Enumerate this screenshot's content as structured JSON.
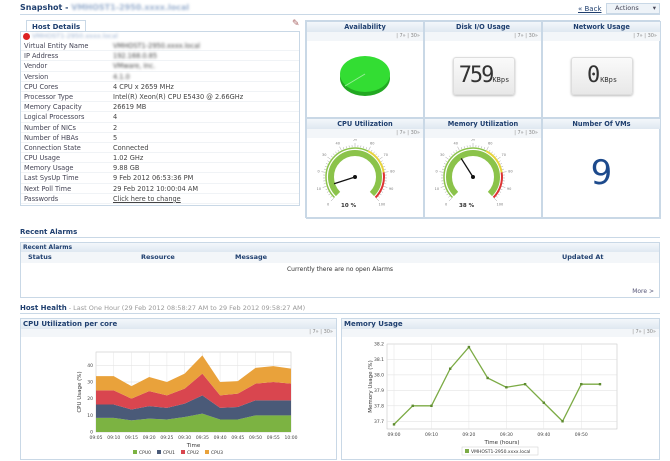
{
  "header": {
    "title": "Snapshot -",
    "host_name": "VMHOST1-2950.xxxx.local",
    "back_label": "« Back",
    "actions_label": "Actions"
  },
  "host_details": {
    "tab": "Host Details",
    "entity": "VMHOST1-2950.xxxx.local",
    "rows": [
      {
        "k": "Virtual Entity Name",
        "v": "VMHOST1-2950.xxxx.local",
        "blur": true
      },
      {
        "k": "IP Address",
        "v": "192.168.0.85",
        "blur": true
      },
      {
        "k": "Vendor",
        "v": "VMware, Inc.",
        "blur": true
      },
      {
        "k": "Version",
        "v": "4.1.0",
        "blur": true
      },
      {
        "k": "CPU Cores",
        "v": "4 CPU x 2659 MHz"
      },
      {
        "k": "Processor Type",
        "v": "Intel(R) Xeon(R) CPU E5430 @ 2.66GHz"
      },
      {
        "k": "Memory Capacity",
        "v": "26619 MB"
      },
      {
        "k": "Logical Processors",
        "v": "4"
      },
      {
        "k": "Number of NICs",
        "v": "2"
      },
      {
        "k": "Number of HBAs",
        "v": "5"
      },
      {
        "k": "Connection State",
        "v": "Connected"
      },
      {
        "k": "CPU Usage",
        "v": "1.02 GHz"
      },
      {
        "k": "Memory Usage",
        "v": "9.88 GB"
      },
      {
        "k": "Last SysUp Time",
        "v": "9 Feb 2012 06:53:36 PM"
      },
      {
        "k": "Next Poll Time",
        "v": "29 Feb 2012 10:00:04 AM"
      },
      {
        "k": "Passwords",
        "v": "Click here to change",
        "link": true
      }
    ]
  },
  "widgets": {
    "range_links": "| 7» | 30»",
    "availability": {
      "title": "Availability",
      "color": "#33cc33"
    },
    "disk": {
      "title": "Disk I/O Usage",
      "value": "759",
      "unit": "KBps"
    },
    "network": {
      "title": "Network Usage",
      "value": "0",
      "unit": "KBps"
    },
    "cpu": {
      "title": "CPU Utilization",
      "percent": 10,
      "label": "10 %"
    },
    "memory": {
      "title": "Memory Utilization",
      "percent": 38,
      "label": "38 %"
    },
    "vms": {
      "title": "Number Of VMs",
      "value": "9"
    },
    "gauge_ticks": [
      "0",
      "10",
      "20",
      "30",
      "40",
      "50",
      "60",
      "70",
      "80",
      "90",
      "100"
    ]
  },
  "alarms": {
    "section_title": "Recent Alarms",
    "panel_title": "Recent Alarms",
    "columns": [
      "Status",
      "Resource",
      "Message",
      "Updated At"
    ],
    "empty": "Currently there are no open Alarms",
    "more": "More >"
  },
  "health": {
    "title": "Host Health",
    "subtitle": "- Last One Hour (29 Feb 2012 08:58:27 AM to 29 Feb 2012 09:58:27 AM)"
  },
  "chart_data": [
    {
      "type": "area",
      "stacked": true,
      "title": "CPU Utilization per core",
      "xlabel": "Time",
      "ylabel": "CPU Usage (%)",
      "ylim": [
        0,
        48
      ],
      "yticks": [
        0,
        10,
        20,
        30,
        40
      ],
      "grid": true,
      "legend": "bottom",
      "x": [
        "09:05",
        "09:10",
        "09:15",
        "09:20",
        "09:25",
        "09:30",
        "09:35",
        "09:40",
        "09:45",
        "09:50",
        "09:55",
        "10:00"
      ],
      "series": [
        {
          "name": "CPU0",
          "color": "#7cb342",
          "values": [
            8.5,
            8.5,
            7,
            8,
            7.5,
            9,
            11,
            7.5,
            7.5,
            10,
            10,
            10
          ]
        },
        {
          "name": "CPU1",
          "color": "#4a5a78",
          "values": [
            8,
            8,
            6.5,
            7.5,
            7,
            8,
            11,
            7,
            7.5,
            9,
            9,
            9
          ]
        },
        {
          "name": "CPU2",
          "color": "#d9464f",
          "values": [
            8.5,
            8.5,
            6.5,
            9,
            7.5,
            9,
            13,
            7.5,
            8,
            10,
            11,
            10
          ]
        },
        {
          "name": "CPU3",
          "color": "#e9a23b",
          "values": [
            8.5,
            8.5,
            7.5,
            8.5,
            8,
            9,
            11,
            8,
            7.5,
            9.5,
            9.5,
            9
          ]
        }
      ]
    },
    {
      "type": "line",
      "title": "Memory Usage",
      "xlabel": "Time (hours)",
      "ylabel": "Memory Usage (%)",
      "ylim": [
        37.65,
        38.2
      ],
      "yticks": [
        "37.7",
        "37.8",
        "37.9",
        "38.0",
        "38.1",
        "38.2"
      ],
      "grid": true,
      "legend": "bottom",
      "x": [
        "09:00",
        "09:05",
        "09:10",
        "09:15",
        "09:20",
        "09:25",
        "09:30",
        "09:35",
        "09:40",
        "09:45",
        "09:50",
        "09:55"
      ],
      "xticks": [
        "09:00",
        "09:10",
        "09:20",
        "09:30",
        "09:40",
        "09:50"
      ],
      "series": [
        {
          "name": "VMHOST1-2950.xxxx.local",
          "color": "#7cab45",
          "values": [
            37.68,
            37.8,
            37.8,
            38.04,
            38.18,
            37.98,
            37.92,
            37.94,
            37.82,
            37.7,
            37.94,
            37.94
          ]
        }
      ]
    }
  ]
}
